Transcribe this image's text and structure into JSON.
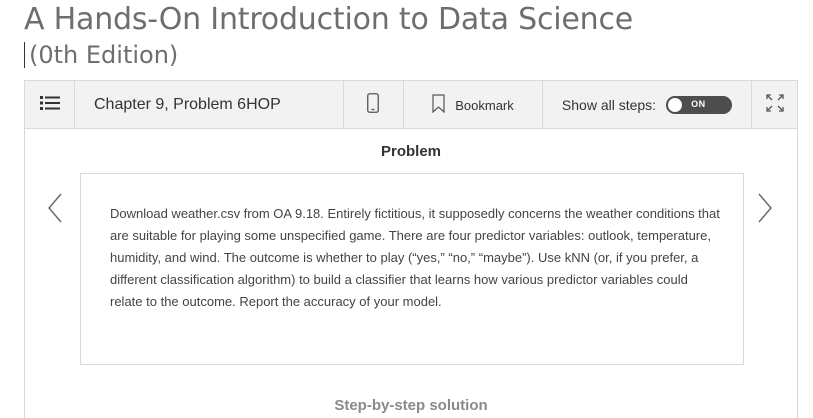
{
  "book": {
    "title": "A Hands-On Introduction to Data Science",
    "edition": "(0th Edition)"
  },
  "toolbar": {
    "menu_icon": "list-icon",
    "chapter_problem": "Chapter 9, Problem 6HOP",
    "mobile_icon": "mobile-phone-icon",
    "bookmark_icon": "bookmark-icon",
    "bookmark_label": "Bookmark",
    "show_all_steps_label": "Show all steps:",
    "toggle_label": "ON",
    "toggle_on": true,
    "expand_icon": "expand-icon"
  },
  "problem": {
    "heading": "Problem",
    "text": "Download weather.csv from OA 9.18. Entirely fictitious, it supposedly concerns the weather conditions that are suitable for playing some unspecified game. There are four predictor variables: outlook, temperature, humidity, and wind. The outcome is whether to play (“yes,” “no,” “maybe”). Use kNN (or, if you prefer, a different classification algorithm) to build a classifier that learns how various predictor variables could relate to the outcome. Report the accuracy of your model."
  },
  "navigation": {
    "prev_icon": "chevron-left-icon",
    "next_icon": "chevron-right-icon"
  },
  "solution": {
    "heading": "Step-by-step solution"
  },
  "colors": {
    "toolbar_bg": "#f2f2f2",
    "border": "#d9d9d9",
    "title_gray": "#6e6e6e",
    "toggle_dark": "#4d4d4d"
  }
}
